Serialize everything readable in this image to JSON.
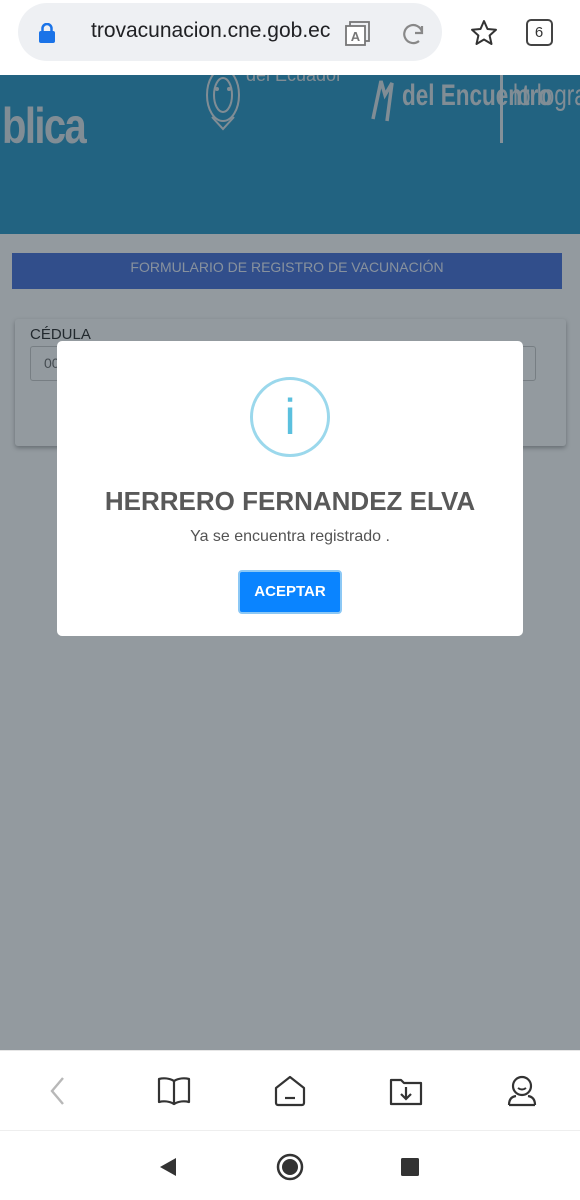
{
  "browser": {
    "url": "trovacunacion.cne.gob.ec",
    "tab_count": "6"
  },
  "banner": {
    "text_left": "blica",
    "text_center": "del Ecuador",
    "text_right_1": "del Encuentro",
    "text_right_2": "lo logram"
  },
  "form": {
    "header": "FORMULARIO DE REGISTRO DE VACUNACIÓN",
    "field_label": "CÉDULA",
    "field_value": "00"
  },
  "modal": {
    "icon_glyph": "i",
    "title": "HERRERO FERNANDEZ ELVA",
    "message": "Ya se encuentra registrado .",
    "button_label": "ACEPTAR"
  },
  "colors": {
    "banner": "#2394c4",
    "form_header": "#3f6ad8",
    "button": "#0a84ff",
    "info_ring": "#9bd8ec",
    "info_glyph": "#5bc0de"
  }
}
